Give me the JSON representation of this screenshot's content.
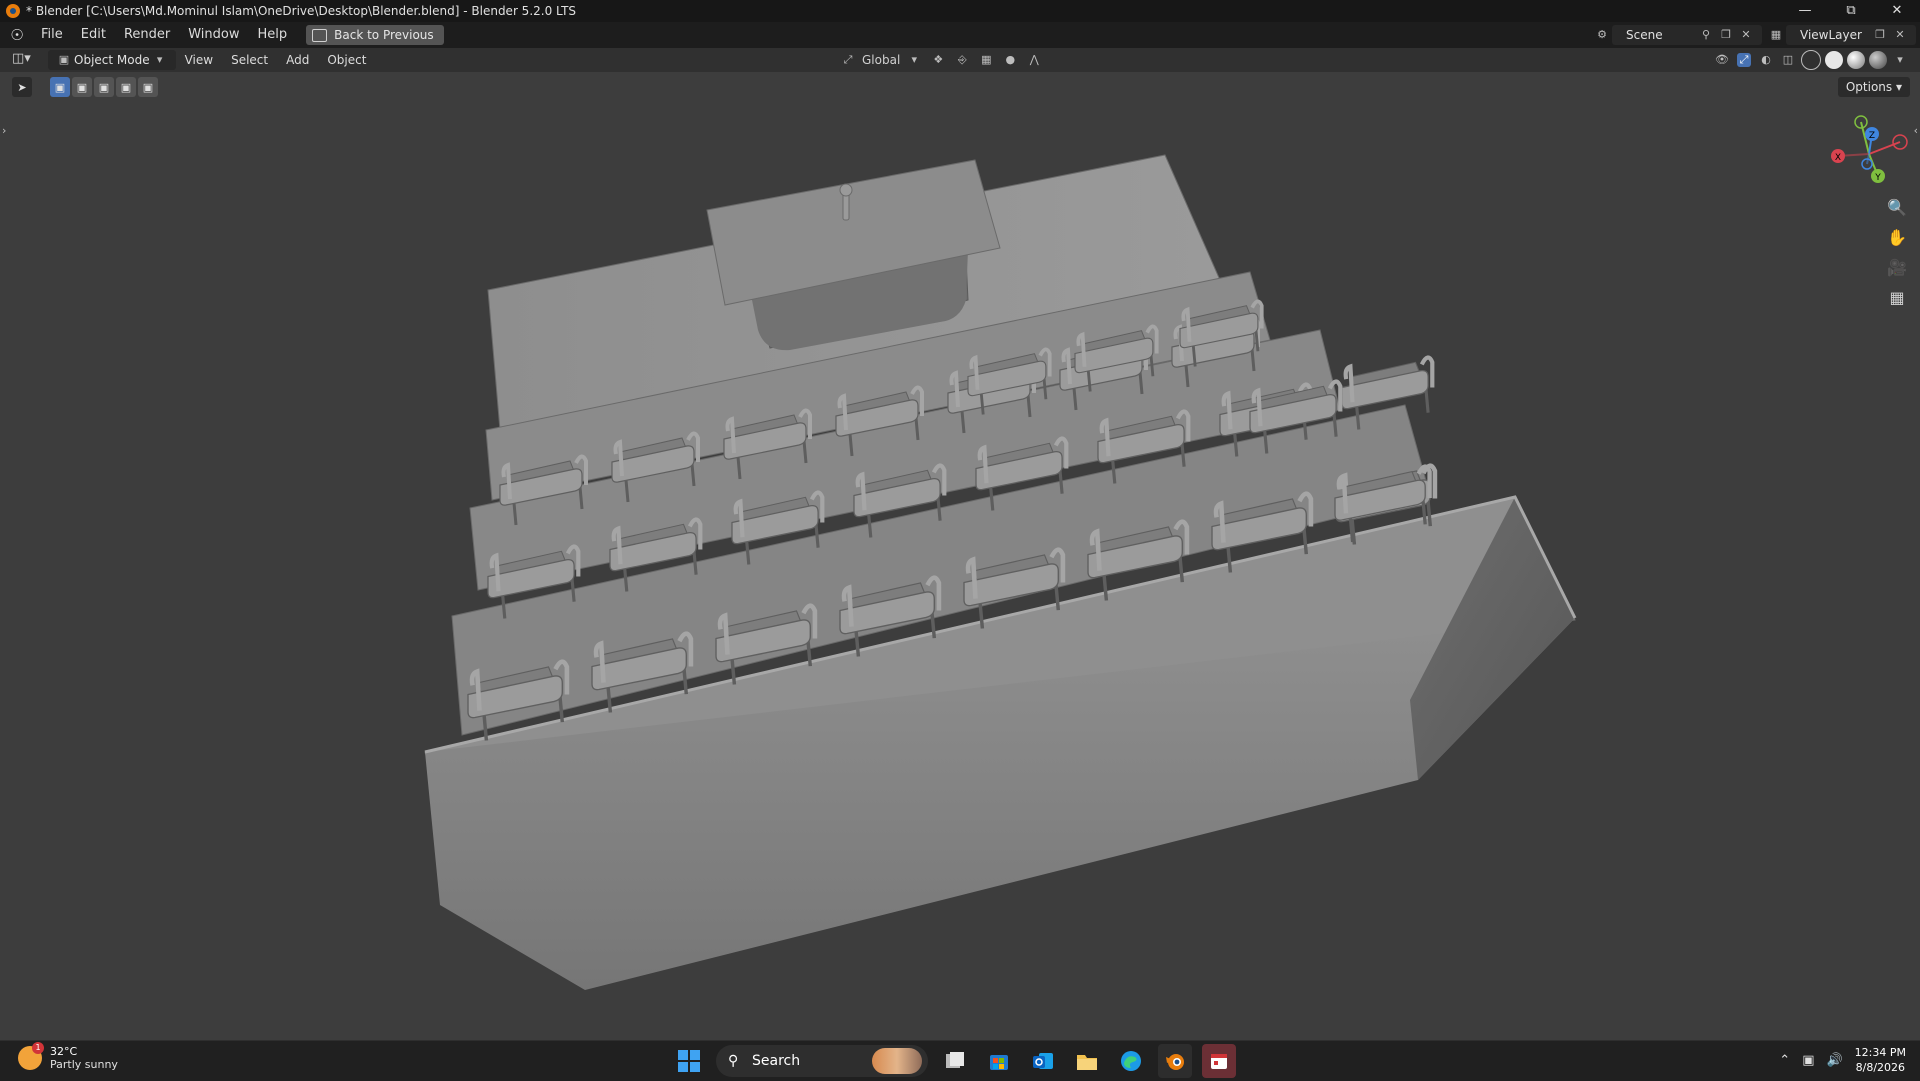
{
  "window": {
    "title": "* Blender [C:\\Users\\Md.Mominul Islam\\OneDrive\\Desktop\\Blender.blend] - Blender 5.2.0 LTS",
    "controls": [
      "minimize-icon",
      "restore-icon",
      "close-icon"
    ]
  },
  "menubar": {
    "items": [
      "File",
      "Edit",
      "Render",
      "Window",
      "Help"
    ],
    "back_button": "Back to Previous",
    "scene": "Scene",
    "view_layer": "ViewLayer"
  },
  "viewport_header": {
    "mode": "Object Mode",
    "menus": [
      "View",
      "Select",
      "Add",
      "Object"
    ],
    "transform_orientation": "Global",
    "options_label": "Options"
  },
  "gizmo": {
    "axes": [
      "X",
      "Y",
      "Z"
    ],
    "colors": {
      "x": "#d9434f",
      "y": "#7fbf3f",
      "z": "#3f86e0"
    }
  },
  "taskbar": {
    "weather_temp": "32°C",
    "weather_desc": "Partly sunny",
    "weather_badge": "1",
    "search_label": "Search",
    "time": "12:34 PM",
    "date": "8/8/2026"
  },
  "colors": {
    "viewport_bg": "#3d3d3d",
    "active_tool": "#4772b3",
    "model_gray": "#8a8a8a"
  }
}
